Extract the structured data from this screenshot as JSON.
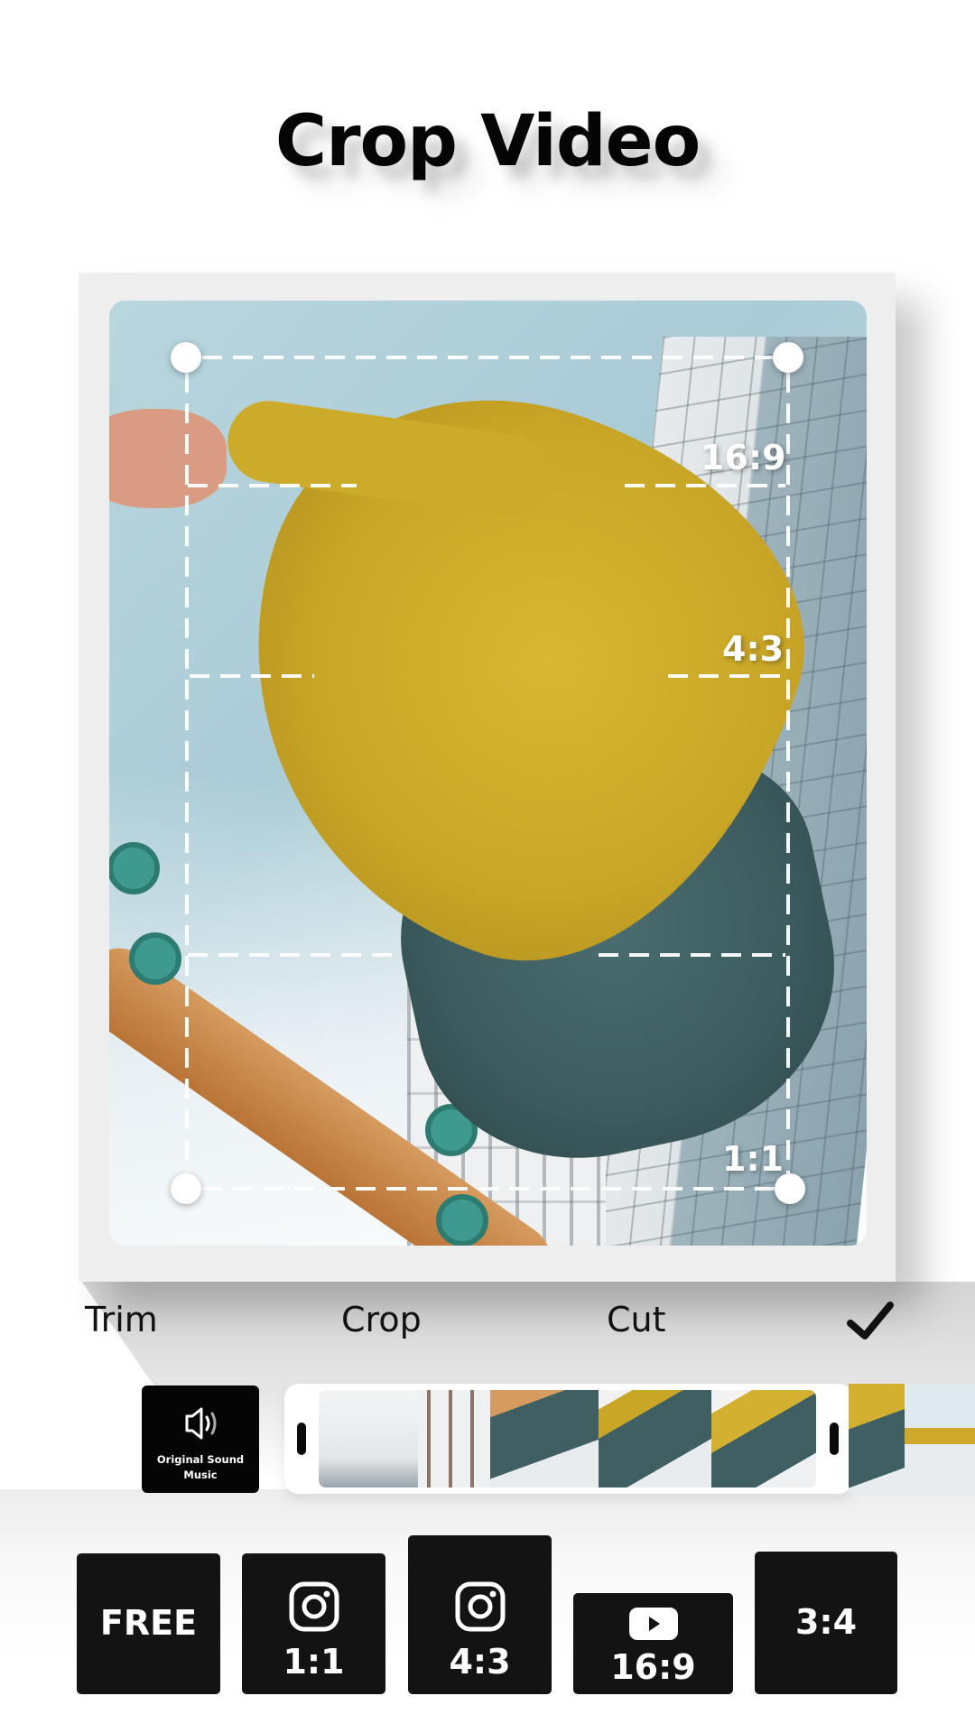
{
  "header": {
    "title": "Crop Video"
  },
  "editor": {
    "ratio_guides": [
      {
        "label": "16:9"
      },
      {
        "label": "4:3"
      },
      {
        "label": "1:1"
      }
    ]
  },
  "tabs": [
    {
      "label": "Trim"
    },
    {
      "label": "Crop"
    },
    {
      "label": "Cut"
    }
  ],
  "confirm_icon": "checkmark-icon",
  "audio": {
    "icon": "speaker-icon",
    "line1": "Original Sound",
    "line2": "Music"
  },
  "ratio_buttons": [
    {
      "label": "FREE",
      "icon": null
    },
    {
      "label": "1:1",
      "icon": "instagram-icon"
    },
    {
      "label": "4:3",
      "icon": "instagram-icon"
    },
    {
      "label": "16:9",
      "icon": "youtube-icon"
    },
    {
      "label": "3:4",
      "icon": null
    }
  ],
  "colors": {
    "button_bg": "#131313",
    "frame_bg": "#eeeeee",
    "text": "#111111",
    "accent_white": "#ffffff"
  }
}
